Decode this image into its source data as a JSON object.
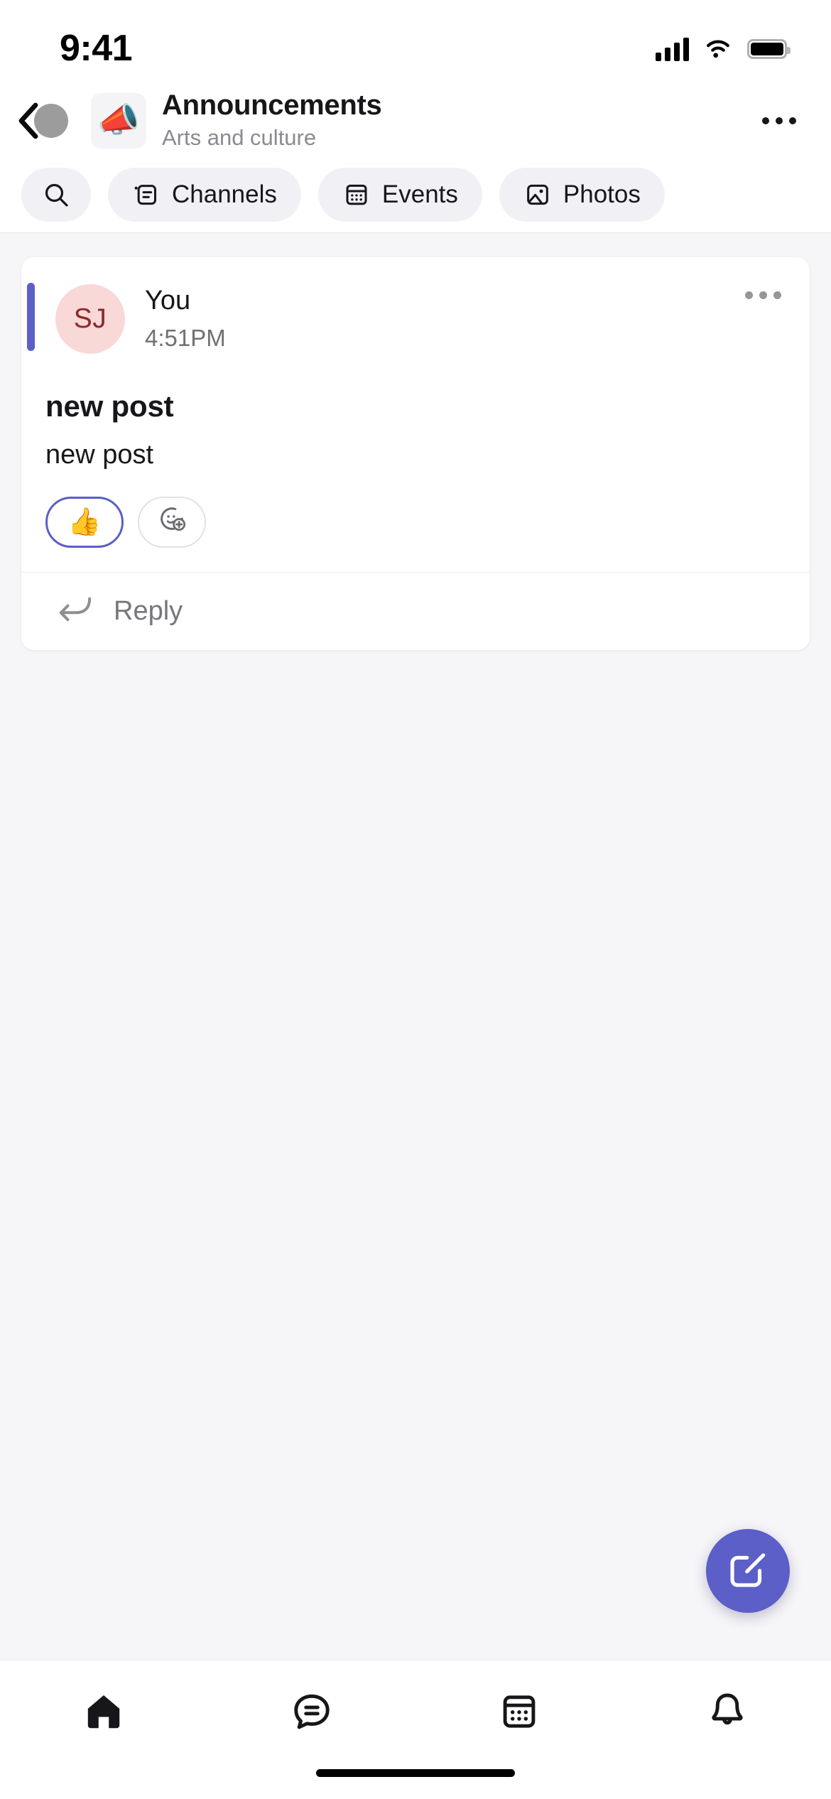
{
  "status_bar": {
    "time": "9:41",
    "icons": [
      "cellular-signal-icon",
      "wifi-icon",
      "battery-icon"
    ]
  },
  "header": {
    "back_icon": "back-chevron-icon",
    "avatar_icon": "user-avatar-icon",
    "team_icon": "megaphone-icon",
    "team_emoji": "📣",
    "title": "Announcements",
    "subtitle": "Arts and culture",
    "more_icon": "more-options-icon"
  },
  "filters": {
    "items": [
      {
        "label": "",
        "icon": "search-icon",
        "icon_only": true
      },
      {
        "label": "Channels",
        "icon": "channels-icon",
        "icon_only": false
      },
      {
        "label": "Events",
        "icon": "calendar-icon",
        "icon_only": false
      },
      {
        "label": "Photos",
        "icon": "photo-icon",
        "icon_only": false
      }
    ]
  },
  "post": {
    "accent_color": "#5B5FC7",
    "avatar_initials": "SJ",
    "avatar_bg": "#F9D8D8",
    "avatar_fg": "#8B2A2A",
    "author": "You",
    "timestamp": "4:51PM",
    "more_icon": "post-more-options-icon",
    "title": "new post",
    "body": "new post",
    "reactions": [
      {
        "emoji": "👍",
        "name": "thumbs-up-reaction",
        "selected": true
      },
      {
        "emoji": "",
        "name": "add-reaction-icon",
        "selected": false
      }
    ],
    "reply_label": "Reply",
    "reply_icon": "reply-arrow-icon"
  },
  "fab": {
    "icon": "compose-icon",
    "color": "#5B5FC7"
  },
  "bottom_nav": {
    "items": [
      {
        "name": "nav-home",
        "icon": "home-icon",
        "active": true
      },
      {
        "name": "nav-chat",
        "icon": "chat-bubble-icon",
        "active": false
      },
      {
        "name": "nav-calendar",
        "icon": "calendar-icon",
        "active": false
      },
      {
        "name": "nav-activity",
        "icon": "bell-icon",
        "active": false
      }
    ]
  },
  "home_indicator": "home-indicator"
}
